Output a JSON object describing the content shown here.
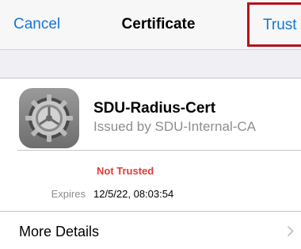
{
  "navbar": {
    "cancel_label": "Cancel",
    "title": "Certificate",
    "trust_label": "Trust"
  },
  "certificate": {
    "icon": "gear-icon",
    "name": "SDU-Radius-Cert",
    "issuer": "Issued by SDU-Internal-CA",
    "status": "Not Trusted",
    "expires_label": "Expires",
    "expires_value": "12/5/22, 08:03:54"
  },
  "more_details": {
    "label": "More Details",
    "icon": "chevron-right-icon"
  },
  "colors": {
    "accent": "#1477d6",
    "warning": "#e53935",
    "highlight_box": "#b5121b",
    "secondary_text": "#8e8e93"
  }
}
